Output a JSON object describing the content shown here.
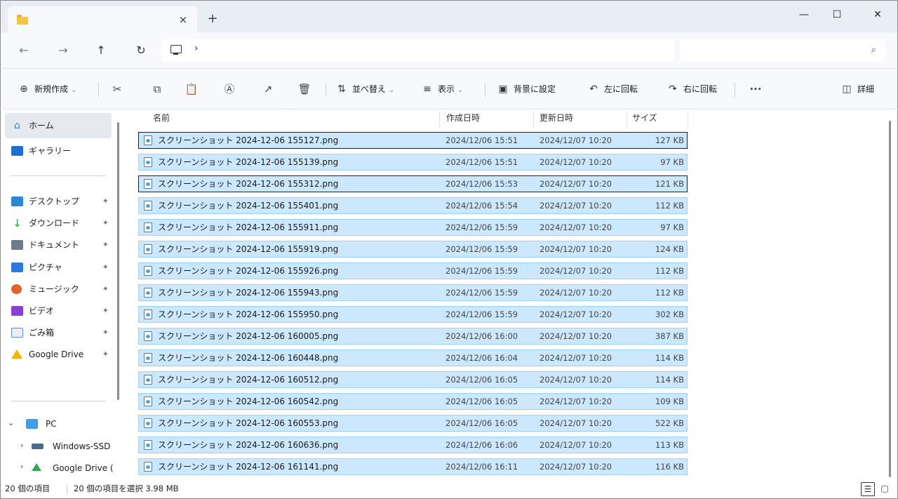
{
  "tab": {
    "close": "×",
    "new": "+"
  },
  "window": {
    "minimize": "—",
    "maximize": "☐",
    "close": "✕"
  },
  "nav": {
    "back": "←",
    "forward": "→",
    "up": "↑",
    "refresh": "↻",
    "chevron": "›",
    "search_icon": "⌕"
  },
  "toolbar": {
    "new_label": "新規作成",
    "sort_label": "並べ替え",
    "view_label": "表示",
    "wallpaper_label": "背景に設定",
    "rotate_left_label": "左に回転",
    "rotate_right_label": "右に回転",
    "more": "···",
    "details_label": "詳細",
    "icons": {
      "new": "⊕",
      "cut": "✂",
      "copy": "⧉",
      "paste": "📋",
      "rename": "Ⓐ",
      "share": "↗",
      "delete": "🗑",
      "sort": "⇅",
      "view": "≡",
      "wallpaper": "▣",
      "rotate_left": "↶",
      "rotate_right": "↷",
      "details": "◫",
      "dropdown": "⌄"
    }
  },
  "sidebar": {
    "home": "ホーム",
    "gallery": "ギャラリー",
    "quick": [
      {
        "label": "デスクトップ",
        "color": "#2b88d8"
      },
      {
        "label": "ダウンロード",
        "color": "#2b9b48"
      },
      {
        "label": "ドキュメント",
        "color": "#6e7b8b"
      },
      {
        "label": "ピクチャ",
        "color": "#2b7bd8"
      },
      {
        "label": "ミュージック",
        "color": "#e0632a"
      },
      {
        "label": "ビデオ",
        "color": "#8a3fd1"
      },
      {
        "label": "ごみ箱",
        "color": "#5a8fb8"
      },
      {
        "label": "Google Drive",
        "color": "#f4b400"
      }
    ],
    "pin": "✦",
    "pc": "PC",
    "drives": [
      "Windows-SSD",
      "Google Drive ("
    ],
    "expand_open": "⌄",
    "expand_closed": "›"
  },
  "columns": {
    "name": "名前",
    "created": "作成日時",
    "modified": "更新日時",
    "size": "サイズ",
    "sort": "^"
  },
  "files": [
    {
      "name": "スクリーンショット 2024-12-06 155127.png",
      "created": "2024/12/06 15:51",
      "modified": "2024/12/07 10:20",
      "size": "127 KB"
    },
    {
      "name": "スクリーンショット 2024-12-06 155139.png",
      "created": "2024/12/06 15:51",
      "modified": "2024/12/07 10:20",
      "size": "97 KB"
    },
    {
      "name": "スクリーンショット 2024-12-06 155312.png",
      "created": "2024/12/06 15:53",
      "modified": "2024/12/07 10:20",
      "size": "121 KB"
    },
    {
      "name": "スクリーンショット 2024-12-06 155401.png",
      "created": "2024/12/06 15:54",
      "modified": "2024/12/07 10:20",
      "size": "112 KB"
    },
    {
      "name": "スクリーンショット 2024-12-06 155911.png",
      "created": "2024/12/06 15:59",
      "modified": "2024/12/07 10:20",
      "size": "97 KB"
    },
    {
      "name": "スクリーンショット 2024-12-06 155919.png",
      "created": "2024/12/06 15:59",
      "modified": "2024/12/07 10:20",
      "size": "124 KB"
    },
    {
      "name": "スクリーンショット 2024-12-06 155926.png",
      "created": "2024/12/06 15:59",
      "modified": "2024/12/07 10:20",
      "size": "112 KB"
    },
    {
      "name": "スクリーンショット 2024-12-06 155943.png",
      "created": "2024/12/06 15:59",
      "modified": "2024/12/07 10:20",
      "size": "112 KB"
    },
    {
      "name": "スクリーンショット 2024-12-06 155950.png",
      "created": "2024/12/06 15:59",
      "modified": "2024/12/07 10:20",
      "size": "302 KB"
    },
    {
      "name": "スクリーンショット 2024-12-06 160005.png",
      "created": "2024/12/06 16:00",
      "modified": "2024/12/07 10:20",
      "size": "387 KB"
    },
    {
      "name": "スクリーンショット 2024-12-06 160448.png",
      "created": "2024/12/06 16:04",
      "modified": "2024/12/07 10:20",
      "size": "114 KB"
    },
    {
      "name": "スクリーンショット 2024-12-06 160512.png",
      "created": "2024/12/06 16:05",
      "modified": "2024/12/07 10:20",
      "size": "114 KB"
    },
    {
      "name": "スクリーンショット 2024-12-06 160542.png",
      "created": "2024/12/06 16:05",
      "modified": "2024/12/07 10:20",
      "size": "109 KB"
    },
    {
      "name": "スクリーンショット 2024-12-06 160553.png",
      "created": "2024/12/06 16:05",
      "modified": "2024/12/07 10:20",
      "size": "522 KB"
    },
    {
      "name": "スクリーンショット 2024-12-06 160636.png",
      "created": "2024/12/06 16:06",
      "modified": "2024/12/07 10:20",
      "size": "113 KB"
    },
    {
      "name": "スクリーンショット 2024-12-06 161141.png",
      "created": "2024/12/06 16:11",
      "modified": "2024/12/07 10:20",
      "size": "116 KB"
    }
  ],
  "status": {
    "count": "20 個の項目",
    "selection": "20 個の項目を選択  3.98 MB"
  },
  "view_buttons": {
    "details": "☰",
    "tiles": "▢"
  }
}
